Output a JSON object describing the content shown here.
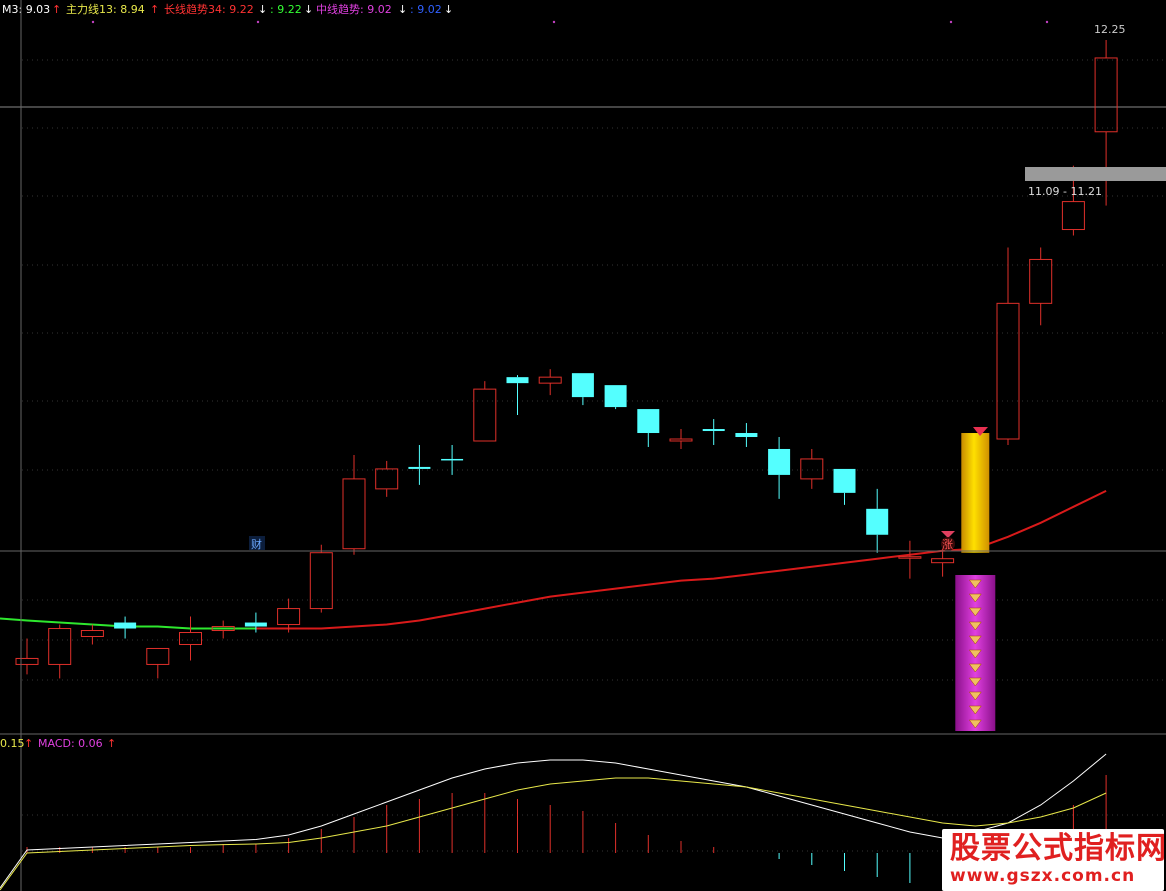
{
  "header": {
    "m3_label": "M3: 9.03",
    "zlx_label": "主力线13: 8.94",
    "cxqs_label": "长线趋势34: 9.22",
    "cxqs_val2": ": 9.22",
    "zxqs_label": "中线趋势: 9.02",
    "zxqs_val2": ": 9.02"
  },
  "macd_header": {
    "left_val": "0.15",
    "macd_label": "MACD: 0.06"
  },
  "annotations": {
    "high_price": "12.25",
    "range_text": "11.09 - 11.21",
    "cai_badge": "财",
    "zhang_badge": "涨"
  },
  "watermark": {
    "line1": "股票公式指标网",
    "line2": "www.gszx.com.cn"
  },
  "colors": {
    "background": "#000000",
    "up": "#e0302a",
    "down": "#54ffff",
    "ma_red": "#d91a1a",
    "ma_green": "#2ee82e",
    "gold": "#ffd700",
    "magenta": "#c020c8",
    "grid": "#444444",
    "header_white": "#ffffff",
    "header_yellow": "#e8e84a",
    "header_red": "#ff3333",
    "header_green": "#33ff33",
    "header_magenta": "#e040e0",
    "header_blue": "#3060ff"
  },
  "chart_data": [
    {
      "type": "candlestick",
      "price_scale": {
        "ref_price": 12.25,
        "ref_label": "12.25"
      },
      "candles": [
        {
          "o": 9.15,
          "h": 9.25,
          "l": 9.07,
          "c": 9.12,
          "dir": "up"
        },
        {
          "o": 9.12,
          "h": 9.32,
          "l": 9.05,
          "c": 9.3,
          "dir": "up"
        },
        {
          "o": 9.26,
          "h": 9.32,
          "l": 9.22,
          "c": 9.29,
          "dir": "up"
        },
        {
          "o": 9.33,
          "h": 9.36,
          "l": 9.25,
          "c": 9.3,
          "dir": "down"
        },
        {
          "o": 9.12,
          "h": 9.2,
          "l": 9.05,
          "c": 9.2,
          "dir": "up"
        },
        {
          "o": 9.22,
          "h": 9.36,
          "l": 9.14,
          "c": 9.28,
          "dir": "up"
        },
        {
          "o": 9.29,
          "h": 9.34,
          "l": 9.25,
          "c": 9.31,
          "dir": "up"
        },
        {
          "o": 9.33,
          "h": 9.38,
          "l": 9.28,
          "c": 9.31,
          "dir": "down"
        },
        {
          "o": 9.32,
          "h": 9.45,
          "l": 9.28,
          "c": 9.4,
          "dir": "up"
        },
        {
          "o": 9.4,
          "h": 9.72,
          "l": 9.38,
          "c": 9.68,
          "dir": "up"
        },
        {
          "o": 9.7,
          "h": 10.17,
          "l": 9.67,
          "c": 10.05,
          "dir": "up"
        },
        {
          "o": 10.0,
          "h": 10.14,
          "l": 9.96,
          "c": 10.1,
          "dir": "up"
        },
        {
          "o": 10.1,
          "h": 10.22,
          "l": 10.02,
          "c": 10.11,
          "dir": "down"
        },
        {
          "o": 10.15,
          "h": 10.22,
          "l": 10.07,
          "c": 10.15,
          "dir": "down"
        },
        {
          "o": 10.24,
          "h": 10.54,
          "l": 10.24,
          "c": 10.5,
          "dir": "up"
        },
        {
          "o": 10.56,
          "h": 10.57,
          "l": 10.37,
          "c": 10.53,
          "dir": "down"
        },
        {
          "o": 10.53,
          "h": 10.6,
          "l": 10.47,
          "c": 10.56,
          "dir": "up"
        },
        {
          "o": 10.58,
          "h": 10.58,
          "l": 10.42,
          "c": 10.46,
          "dir": "down"
        },
        {
          "o": 10.52,
          "h": 10.52,
          "l": 10.4,
          "c": 10.41,
          "dir": "down"
        },
        {
          "o": 10.4,
          "h": 10.4,
          "l": 10.21,
          "c": 10.28,
          "dir": "down"
        },
        {
          "o": 10.24,
          "h": 10.3,
          "l": 10.2,
          "c": 10.25,
          "dir": "up"
        },
        {
          "o": 10.3,
          "h": 10.35,
          "l": 10.22,
          "c": 10.29,
          "dir": "down"
        },
        {
          "o": 10.28,
          "h": 10.33,
          "l": 10.21,
          "c": 10.26,
          "dir": "down"
        },
        {
          "o": 10.2,
          "h": 10.26,
          "l": 9.95,
          "c": 10.07,
          "dir": "down"
        },
        {
          "o": 10.05,
          "h": 10.2,
          "l": 10.0,
          "c": 10.15,
          "dir": "up"
        },
        {
          "o": 10.1,
          "h": 10.1,
          "l": 9.92,
          "c": 9.98,
          "dir": "down"
        },
        {
          "o": 9.9,
          "h": 10.0,
          "l": 9.68,
          "c": 9.77,
          "dir": "down"
        },
        {
          "o": 9.66,
          "h": 9.74,
          "l": 9.55,
          "c": 9.66,
          "dir": "up"
        },
        {
          "o": 9.63,
          "h": 9.7,
          "l": 9.56,
          "c": 9.65,
          "dir": "up"
        },
        {
          "o": 9.68,
          "h": 10.28,
          "l": 9.68,
          "c": 10.28,
          "dir": "up",
          "highlight": "gold"
        },
        {
          "o": 10.25,
          "h": 11.21,
          "l": 10.22,
          "c": 10.93,
          "dir": "up"
        },
        {
          "o": 10.93,
          "h": 11.21,
          "l": 10.82,
          "c": 11.15,
          "dir": "up"
        },
        {
          "o": 11.3,
          "h": 11.62,
          "l": 11.27,
          "c": 11.44,
          "dir": "up"
        },
        {
          "o": 11.79,
          "h": 12.25,
          "l": 11.42,
          "c": 12.16,
          "dir": "up"
        }
      ],
      "ma_line": {
        "values": [
          9.34,
          9.33,
          9.32,
          9.31,
          9.31,
          9.3,
          9.3,
          9.3,
          9.3,
          9.3,
          9.31,
          9.32,
          9.34,
          9.37,
          9.4,
          9.43,
          9.46,
          9.48,
          9.5,
          9.52,
          9.54,
          9.55,
          9.57,
          9.59,
          9.61,
          9.63,
          9.65,
          9.67,
          9.69,
          9.7,
          9.76,
          9.83,
          9.91,
          9.99
        ],
        "green_until_index": 7
      },
      "markers": [
        {
          "index": 7,
          "label": "财"
        },
        {
          "index": 29,
          "label": "涨"
        }
      ]
    },
    {
      "type": "bar",
      "name": "signal",
      "highlight_index": 29,
      "stacked_icons": 11
    },
    {
      "type": "line",
      "name": "MACD",
      "series": [
        {
          "name": "DIF",
          "values": [
            0.01,
            0.015,
            0.02,
            0.025,
            0.03,
            0.035,
            0.04,
            0.045,
            0.06,
            0.09,
            0.13,
            0.17,
            0.21,
            0.25,
            0.28,
            0.3,
            0.31,
            0.31,
            0.3,
            0.28,
            0.26,
            0.24,
            0.22,
            0.19,
            0.16,
            0.13,
            0.1,
            0.07,
            0.05,
            0.07,
            0.1,
            0.16,
            0.24,
            0.33
          ]
        },
        {
          "name": "DEA",
          "values": [
            0.0,
            0.005,
            0.01,
            0.015,
            0.02,
            0.025,
            0.028,
            0.03,
            0.035,
            0.05,
            0.07,
            0.09,
            0.12,
            0.15,
            0.18,
            0.21,
            0.23,
            0.24,
            0.25,
            0.25,
            0.24,
            0.23,
            0.22,
            0.2,
            0.18,
            0.16,
            0.14,
            0.12,
            0.1,
            0.09,
            0.1,
            0.12,
            0.15,
            0.2
          ]
        },
        {
          "name": "MACD",
          "values": [
            0.02,
            0.02,
            0.02,
            0.02,
            0.02,
            0.02,
            0.03,
            0.03,
            0.05,
            0.08,
            0.12,
            0.16,
            0.18,
            0.2,
            0.2,
            0.18,
            0.16,
            0.14,
            0.1,
            0.06,
            0.04,
            0.02,
            0.0,
            -0.02,
            -0.04,
            -0.06,
            -0.08,
            -0.1,
            -0.1,
            -0.04,
            0.0,
            0.08,
            0.16,
            0.26
          ]
        }
      ]
    }
  ]
}
